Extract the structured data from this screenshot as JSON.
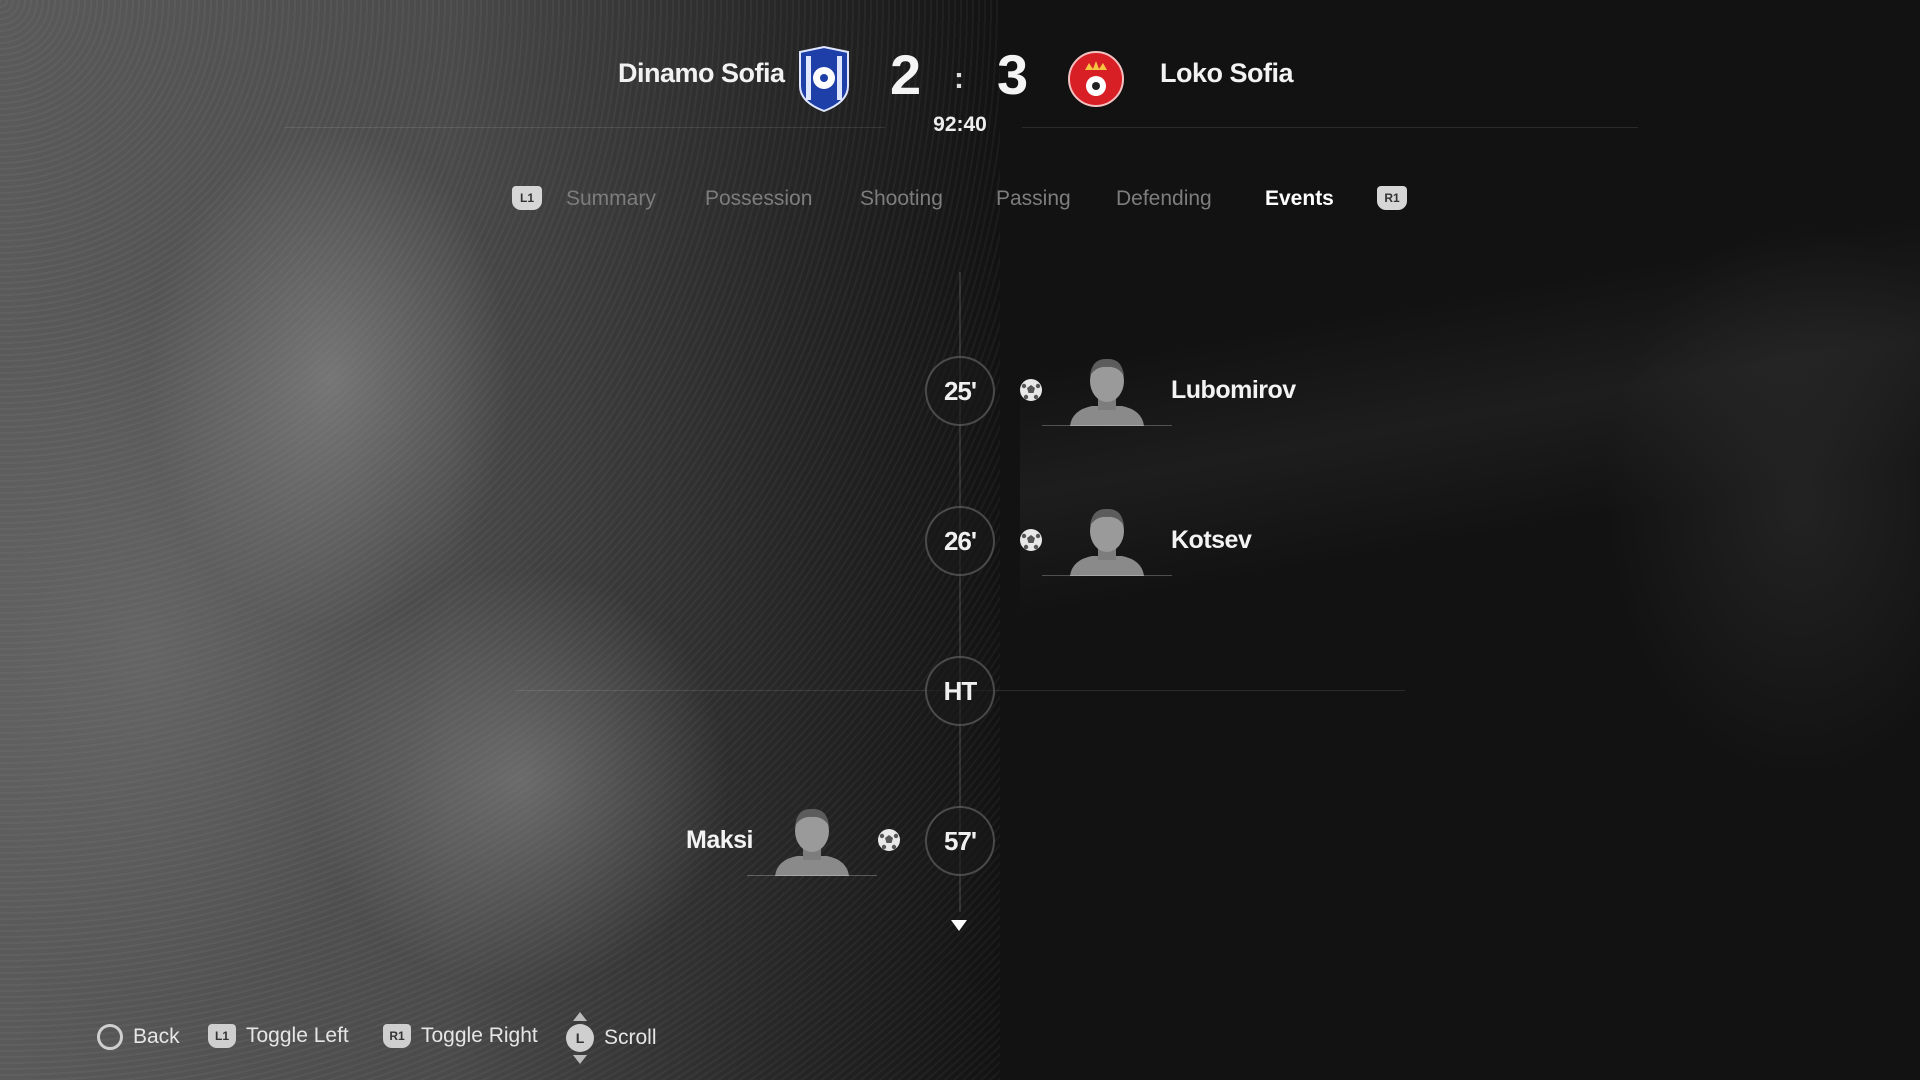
{
  "match": {
    "home_team": "Dinamo Sofia",
    "away_team": "Loko Sofia",
    "home_score": "2",
    "away_score": "3",
    "separator": ":",
    "clock": "92:40"
  },
  "tabs": {
    "left_bumper": "L1",
    "right_bumper": "R1",
    "items": [
      {
        "label": "Summary",
        "active": false
      },
      {
        "label": "Possession",
        "active": false
      },
      {
        "label": "Shooting",
        "active": false
      },
      {
        "label": "Passing",
        "active": false
      },
      {
        "label": "Defending",
        "active": false
      },
      {
        "label": "Events",
        "active": true
      }
    ]
  },
  "events": [
    {
      "minute": "25'",
      "side": "away",
      "type": "goal",
      "player": "Lubomirov"
    },
    {
      "minute": "26'",
      "side": "away",
      "type": "goal",
      "player": "Kotsev"
    },
    {
      "minute": "HT",
      "side": "none",
      "type": "half-time",
      "player": ""
    },
    {
      "minute": "57'",
      "side": "home",
      "type": "goal",
      "player": "Maksi"
    }
  ],
  "footer": {
    "back": {
      "button": "circle",
      "label": "Back"
    },
    "toggle_left": {
      "button": "L1",
      "label": "Toggle Left"
    },
    "toggle_right": {
      "button": "R1",
      "label": "Toggle Right"
    },
    "scroll": {
      "button": "L",
      "label": "Scroll"
    }
  },
  "colors": {
    "home_crest": "#1f3fa8",
    "away_crest": "#d81f26",
    "accent_text": "#ffffff",
    "inactive_tab": "#7d7d7d"
  }
}
